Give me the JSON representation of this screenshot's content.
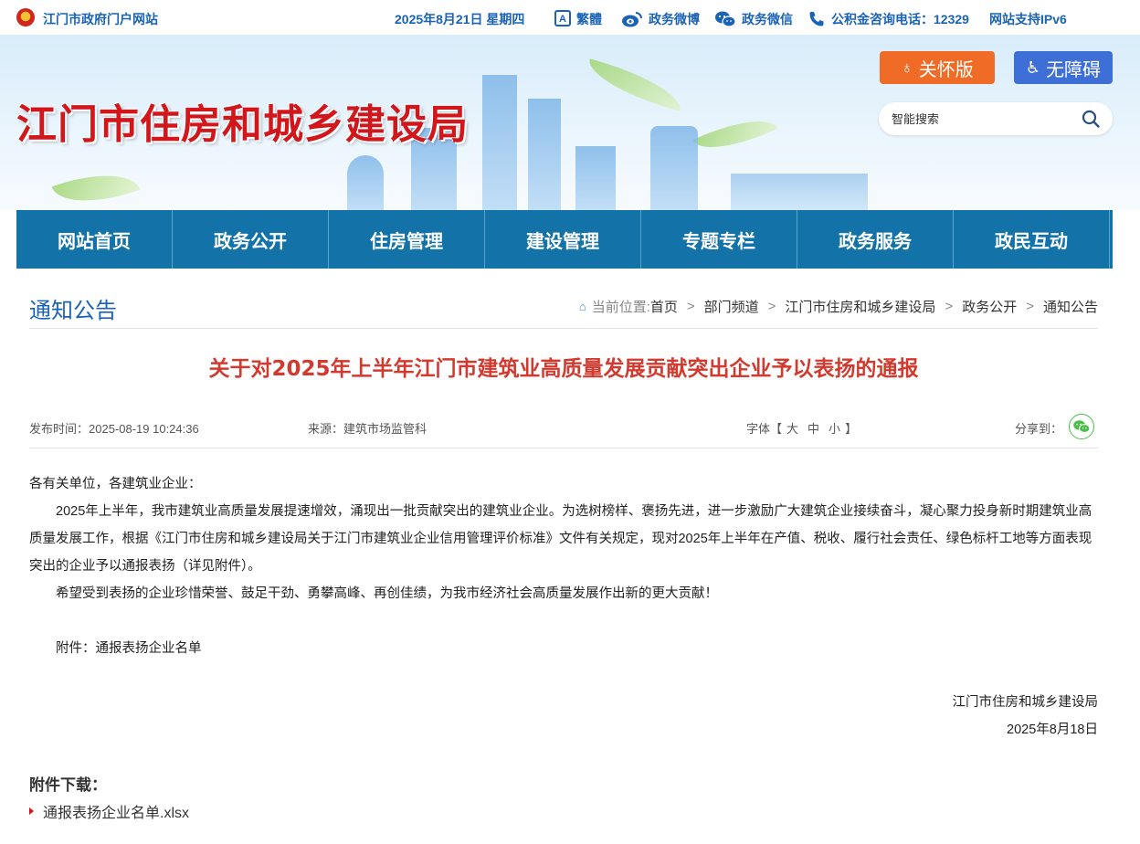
{
  "topbar": {
    "portal": "江门市政府门户网站",
    "date": "2025年8月21日 星期四",
    "traditional": "繁體",
    "weibo": "政务微博",
    "wechat": "政务微信",
    "hotline": "公积金咨询电话：12329",
    "ipv6": "网站支持IPv6"
  },
  "banner": {
    "site_title": "江门市住房和城乡建设局",
    "care_label": "关怀版",
    "accessible_label": "无障碍",
    "search_placeholder": "智能搜索"
  },
  "nav": {
    "items": [
      {
        "label": "网站首页"
      },
      {
        "label": "政务公开"
      },
      {
        "label": "住房管理"
      },
      {
        "label": "建设管理"
      },
      {
        "label": "专题专栏"
      },
      {
        "label": "政务服务"
      },
      {
        "label": "政民互动"
      }
    ]
  },
  "section": {
    "title": "通知公告"
  },
  "breadcrumb": {
    "label": "当前位置:",
    "items": [
      "首页",
      "部门频道",
      "江门市住房和城乡建设局",
      "政务公开",
      "通知公告"
    ]
  },
  "article": {
    "title": "关于对2025年上半年江门市建筑业高质量发展贡献突出企业予以表扬的通报",
    "publish_time": "发布时间：2025-08-19 10:24:36",
    "source": "来源：建筑市场监管科",
    "font_label": "字体【",
    "font_large": "大",
    "font_medium": "中",
    "font_small": "小",
    "font_close": "】",
    "share_label": "分享到：",
    "salutation": "各有关单位，各建筑业企业：",
    "para1": "2025年上半年，我市建筑业高质量发展提速增效，涌现出一批贡献突出的建筑业企业。为选树榜样、褒扬先进，进一步激励广大建筑企业接续奋斗，凝心聚力投身新时期建筑业高质量发展工作，根据《江门市住房和城乡建设局关于江门市建筑业企业信用管理评价标准》文件有关规定，现对2025年上半年在产值、税收、履行社会责任、绿色标杆工地等方面表现突出的企业予以通报表扬（详见附件）。",
    "para2": "希望受到表扬的企业珍惜荣誉、鼓足干劲、勇攀高峰、再创佳绩，为我市经济社会高质量发展作出新的更大贡献！",
    "attachment_note": "附件：通报表扬企业名单",
    "signature": "江门市住房和城乡建设局",
    "sign_date": "2025年8月18日"
  },
  "attachments": {
    "heading": "附件下载：",
    "items": [
      {
        "name": "通报表扬企业名单.xlsx"
      }
    ]
  }
}
